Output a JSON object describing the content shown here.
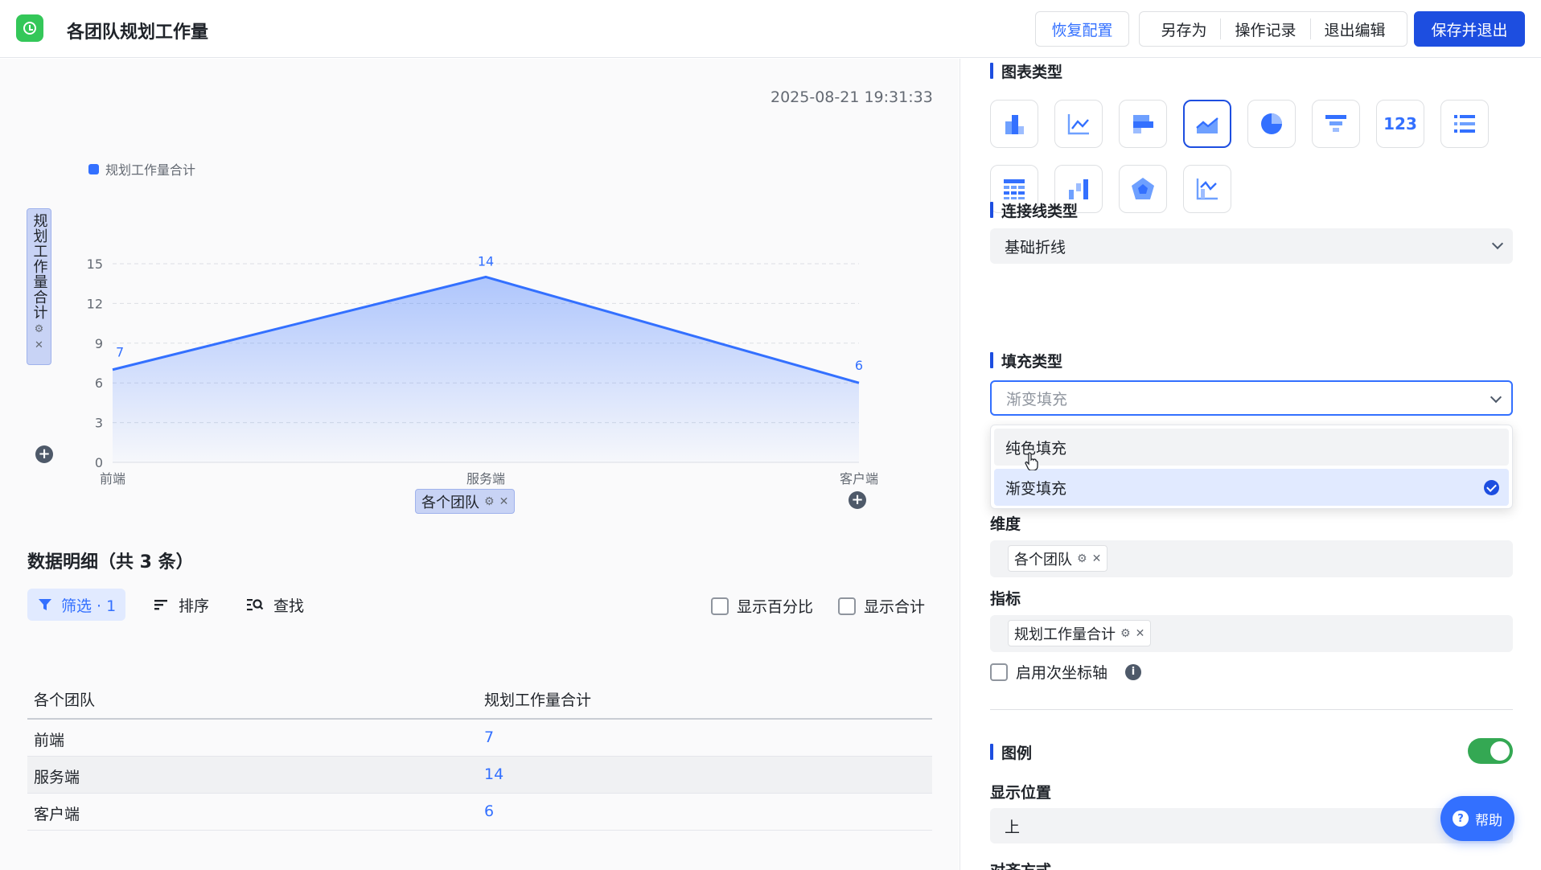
{
  "header": {
    "title": "各团队规划工作量",
    "restore_label": "恢复配置",
    "save_as_label": "另存为",
    "history_label": "操作记录",
    "exit_edit_label": "退出编辑",
    "save_exit_label": "保存并退出"
  },
  "chart": {
    "timestamp": "2025-08-21 19:31:33",
    "legend_label": "规划工作量合计",
    "y_axis_field": "规划工作量合计",
    "x_axis_field": "各个团队",
    "accent_color": "#3370ff"
  },
  "chart_data": {
    "type": "area",
    "categories": [
      "前端",
      "服务端",
      "客户端"
    ],
    "series": [
      {
        "name": "规划工作量合计",
        "values": [
          7,
          14,
          6
        ]
      }
    ],
    "yticks": [
      0,
      3,
      6,
      9,
      12,
      15
    ],
    "ylim": [
      0,
      15
    ],
    "legend": "top-left",
    "fill": "gradient"
  },
  "table": {
    "title": "数据明细（共 3 条）",
    "filter_label": "筛选 · 1",
    "sort_label": "排序",
    "find_label": "查找",
    "show_percent_label": "显示百分比",
    "show_total_label": "显示合计",
    "columns": [
      "各个团队",
      "规划工作量合计"
    ],
    "rows": [
      {
        "team": "前端",
        "value": "7"
      },
      {
        "team": "服务端",
        "value": "14"
      },
      {
        "team": "客户端",
        "value": "6"
      }
    ]
  },
  "panel": {
    "chart_type_title": "图表类型",
    "chart_type_icons": [
      "bar-chart-icon",
      "line-chart-icon",
      "horizontal-bar-icon",
      "area-chart-icon",
      "pie-chart-icon",
      "funnel-icon",
      "number-card-icon",
      "list-icon",
      "table-icon",
      "waterfall-icon",
      "radar-icon",
      "dual-axis-icon"
    ],
    "chart_type_number_label": "123",
    "line_type_title": "连接线类型",
    "line_type_value": "基础折线",
    "fill_type_title": "填充类型",
    "fill_type_value": "渐变填充",
    "fill_options": [
      "纯色填充",
      "渐变填充"
    ],
    "dimension_title": "维度",
    "dimension_tag": "各个团队",
    "metric_title": "指标",
    "metric_tag": "规划工作量合计",
    "secondary_axis_label": "启用次坐标轴",
    "legend_title": "图例",
    "legend_enabled": true,
    "position_title": "显示位置",
    "position_value": "上",
    "align_title": "对齐方式",
    "help_label": "帮助"
  }
}
